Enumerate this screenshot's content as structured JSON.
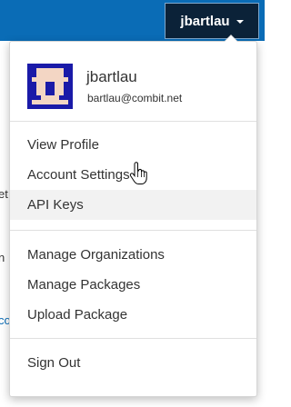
{
  "topbar": {
    "username": "jbartlau"
  },
  "background_fragments": [
    {
      "text": "et",
      "link": false
    },
    {
      "text": "n",
      "link": false
    },
    {
      "text": "co",
      "link": true
    }
  ],
  "dropdown": {
    "user": {
      "name": "jbartlau",
      "email": "bartlau@combit.net"
    },
    "groups": [
      {
        "items": [
          {
            "label": "View Profile"
          },
          {
            "label": "Account Settings"
          },
          {
            "label": "API Keys",
            "hovered": true
          }
        ]
      },
      {
        "items": [
          {
            "label": "Manage Organizations"
          },
          {
            "label": "Manage Packages"
          },
          {
            "label": "Upload Package"
          }
        ]
      },
      {
        "items": [
          {
            "label": "Sign Out"
          }
        ]
      }
    ]
  },
  "colors": {
    "topbar": "#0a6cb6",
    "user_toggle": "#0b2238",
    "avatar": "#1a1aa8",
    "hover_bg": "#f2f2f2"
  }
}
